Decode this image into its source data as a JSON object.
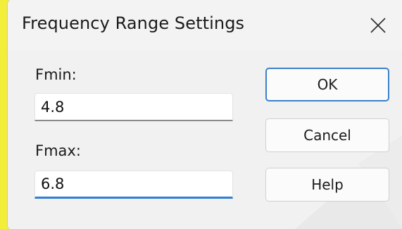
{
  "dialog": {
    "title": "Frequency Range Settings",
    "close_icon": "close-icon"
  },
  "fields": {
    "fmin": {
      "label": "Fmin:",
      "value": "4.8"
    },
    "fmax": {
      "label": "Fmax:",
      "value": "6.8"
    }
  },
  "buttons": {
    "ok": "OK",
    "cancel": "Cancel",
    "help": "Help"
  },
  "colors": {
    "accent": "#2f7fd6",
    "desktop_edge": "#f3ee3a"
  }
}
